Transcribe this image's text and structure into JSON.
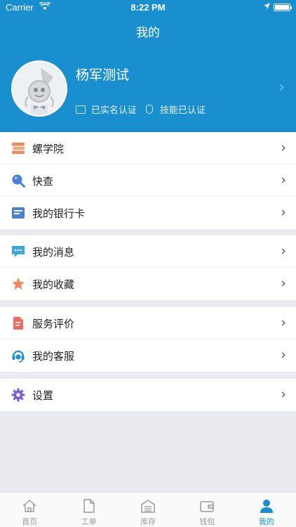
{
  "status_bar": {
    "carrier": "Carrier",
    "time": "8:22 PM"
  },
  "header": {
    "title": "我的"
  },
  "profile": {
    "name": "杨军测试",
    "verified_label": "已实名认证",
    "skill_label": "技能已认证"
  },
  "menu": {
    "group1": [
      {
        "label": "螺学院",
        "icon": "book-stack-icon",
        "color": "#f08a5d"
      },
      {
        "label": "快查",
        "icon": "search-icon",
        "color": "#4a7fd6"
      },
      {
        "label": "我的银行卡",
        "icon": "bank-card-icon",
        "color": "#4a7fd6"
      }
    ],
    "group2": [
      {
        "label": "我的消息",
        "icon": "message-icon",
        "color": "#3aa6dc"
      },
      {
        "label": "我的收藏",
        "icon": "star-icon",
        "color": "#f08a5d"
      }
    ],
    "group3": [
      {
        "label": "服务评价",
        "icon": "document-edit-icon",
        "color": "#f06b5d"
      },
      {
        "label": "我的客服",
        "icon": "headset-icon",
        "color": "#1a8fd0"
      }
    ],
    "group4": [
      {
        "label": "设置",
        "icon": "gear-icon",
        "color": "#7a5fd0"
      }
    ]
  },
  "tabbar": {
    "tabs": [
      {
        "label": "首页",
        "icon": "home-icon"
      },
      {
        "label": "工单",
        "icon": "document-icon"
      },
      {
        "label": "库存",
        "icon": "warehouse-icon"
      },
      {
        "label": "钱包",
        "icon": "wallet-icon"
      },
      {
        "label": "我的",
        "icon": "person-icon"
      }
    ],
    "active_index": 4
  },
  "colors": {
    "brand": "#1a8fd0",
    "background": "#e9ebf0"
  }
}
